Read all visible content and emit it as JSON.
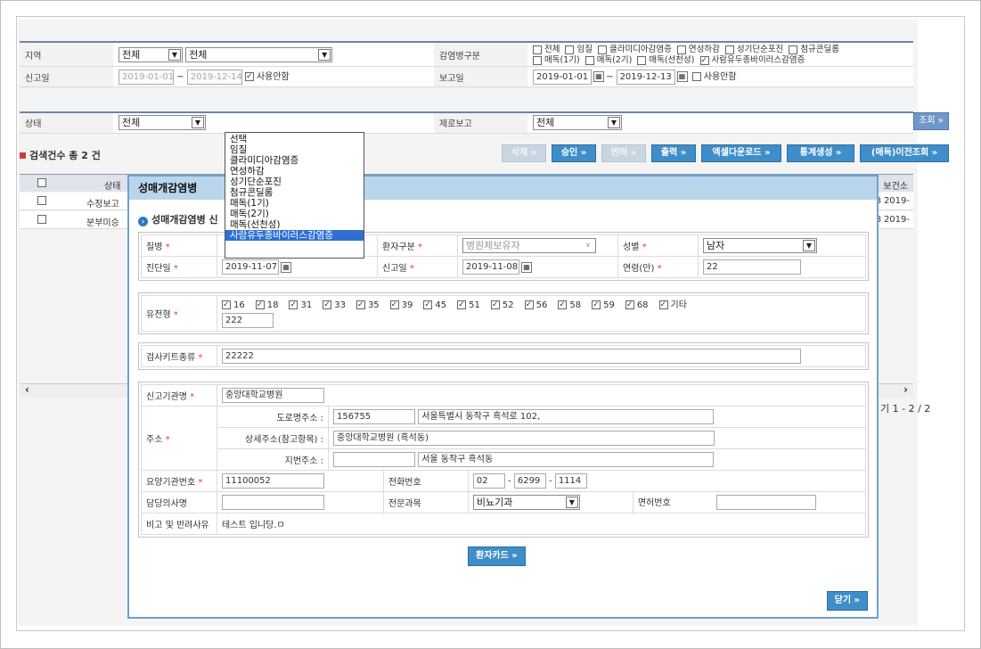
{
  "search": {
    "region_label": "지역",
    "region_value1": "전체",
    "region_value2": "전체",
    "disease_type_label": "감염병구분",
    "disease_checks": [
      {
        "label": "전체",
        "checked": false
      },
      {
        "label": "임질",
        "checked": false
      },
      {
        "label": "클라미디아감염증",
        "checked": false
      },
      {
        "label": "연성하감",
        "checked": false
      },
      {
        "label": "성기단순포진",
        "checked": false
      },
      {
        "label": "첨규콘딜롬",
        "checked": false
      },
      {
        "label": "매독(1기)",
        "checked": false
      },
      {
        "label": "매독(2기)",
        "checked": false
      },
      {
        "label": "매독(선천성)",
        "checked": false
      },
      {
        "label": "사람유두종바이러스감염증",
        "checked": true
      }
    ],
    "report_date_label": "신고일",
    "report_date_from": "2019-01-01",
    "report_date_to": "2019-12-14",
    "report_date_unused": "사용안함",
    "report_label": "보고일",
    "report_from": "2019-01-01",
    "report_to": "2019-12-13",
    "report_unused": "사용안함",
    "status_label": "상태",
    "status_value": "전체",
    "zero_report_label": "제로보고",
    "zero_report_value": "전체",
    "search_button": "조회 »"
  },
  "results": {
    "count_text": "검색건수 총 2 건",
    "buttons": {
      "delete": "삭제 »",
      "approve": "승인 »",
      "reject": "반려 »",
      "print": "출력 »",
      "excel": "엑셀다운로드 »",
      "stats": "통계생성 »",
      "prev": "(매독)이전조회 »"
    },
    "col_status": "상태",
    "col_health": "보건소",
    "rows": [
      {
        "status": "수정보고",
        "code": "08",
        "date": "2019-"
      },
      {
        "status": "분부미승",
        "code": "08",
        "date": "2019-"
      }
    ],
    "paging": "1 - 2 / 2"
  },
  "modal": {
    "title": "성매개감염병",
    "subtitle": "성매개감염병 신",
    "disease_label": "질병",
    "patient_type_label": "환자구분",
    "patient_type_value": "병원체보유자",
    "gender_label": "성별",
    "gender_value": "남자",
    "diag_date_label": "진단일",
    "diag_date_value": "2019-11-07",
    "report_date_label": "신고일",
    "report_date_value": "2019-11-08",
    "age_label": "연령(만)",
    "age_value": "22",
    "genotype_label": "유전형",
    "genotypes": [
      "16",
      "18",
      "31",
      "33",
      "35",
      "39",
      "45",
      "51",
      "52",
      "56",
      "58",
      "59",
      "68",
      "기타"
    ],
    "genotype_other": "222",
    "kit_label": "검사키트종류",
    "kit_value": "22222",
    "institution_label": "신고기관명",
    "institution_value": "중앙대학교병원",
    "address_label": "주소",
    "road_label": "도로명주소 :",
    "postcode": "156755",
    "road_value": "서울특별시 동작구 흑석로 102,",
    "detail_label": "상세주소(참고항목) :",
    "detail_value": "중앙대학교병원 (흑석동)",
    "lot_label": "지번주소 :",
    "lot_value": "서울 동작구 흑석동",
    "care_no_label": "요양기관번호",
    "care_no_value": "11100052",
    "phone_label": "전화번호",
    "phone1": "02",
    "phone2": "6299",
    "phone3": "1114",
    "doctor_label": "담당의사명",
    "dept_label": "전문과목",
    "dept_value": "비뇨기과",
    "license_label": "면허번호",
    "remark_label": "비고 및 반려사유",
    "remark_value": "테스트 입니당.ㅁ",
    "card_button": "환자카드 »",
    "close_button": "닫기 »"
  },
  "dropdown": {
    "items": [
      "선택",
      "임질",
      "클라미디아감염증",
      "연성하감",
      "성기단순포진",
      "첨규콘딜롬",
      "매독(1기)",
      "매독(2기)",
      "매독(선천성)",
      "사람유두종바이러스감염증"
    ],
    "highlighted": "사람유두종바이러스감염증"
  }
}
